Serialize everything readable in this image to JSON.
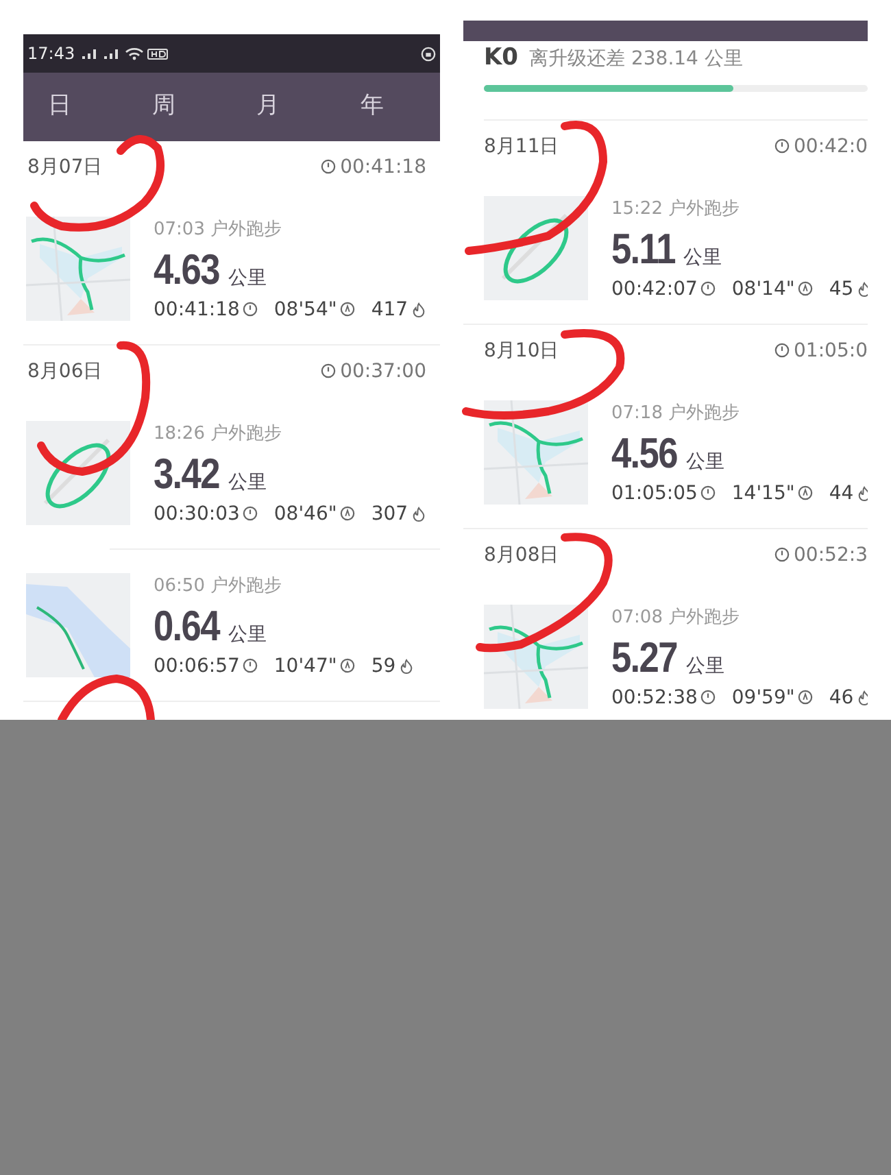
{
  "left_screen": {
    "status_bar": {
      "time": "17:43"
    },
    "tabs": [
      {
        "label": "日",
        "selected": false
      },
      {
        "label": "周",
        "selected": false
      },
      {
        "label": "月",
        "selected": false
      },
      {
        "label": "年",
        "selected": false
      }
    ],
    "days": [
      {
        "date": "8月07日",
        "duration": "00:41:18",
        "activities": [
          {
            "time": "07:03",
            "type": "户外跑步",
            "distance": "4.63",
            "unit": "公里",
            "duration": "00:41:18",
            "pace": "08'54\"",
            "calories": "417"
          }
        ]
      },
      {
        "date": "8月06日",
        "duration": "00:37:00",
        "activities": [
          {
            "time": "18:26",
            "type": "户外跑步",
            "distance": "3.42",
            "unit": "公里",
            "duration": "00:30:03",
            "pace": "08'46\"",
            "calories": "307"
          },
          {
            "time": "06:50",
            "type": "户外跑步",
            "distance": "0.64",
            "unit": "公里",
            "duration": "00:06:57",
            "pace": "10'47\"",
            "calories": "59"
          }
        ]
      }
    ]
  },
  "right_screen": {
    "level_badge": "K0",
    "level_text": "离升级还差 238.14 公里",
    "progress": {
      "level": 0.65
    },
    "days": [
      {
        "date": "8月11日",
        "duration": "00:42:0",
        "activities": [
          {
            "time": "15:22",
            "type": "户外跑步",
            "distance": "5.11",
            "unit": "公里",
            "duration": "00:42:07",
            "pace": "08'14\"",
            "calories": "45"
          }
        ]
      },
      {
        "date": "8月10日",
        "duration": "01:05:0",
        "activities": [
          {
            "time": "07:18",
            "type": "户外跑步",
            "distance": "4.56",
            "unit": "公里",
            "duration": "01:05:05",
            "pace": "14'15\"",
            "calories": "44"
          }
        ]
      },
      {
        "date": "8月08日",
        "duration": "00:52:3",
        "activities": [
          {
            "time": "07:08",
            "type": "户外跑步",
            "distance": "5.27",
            "unit": "公里",
            "duration": "00:52:38",
            "pace": "09'59\"",
            "calories": "46"
          }
        ]
      }
    ]
  }
}
